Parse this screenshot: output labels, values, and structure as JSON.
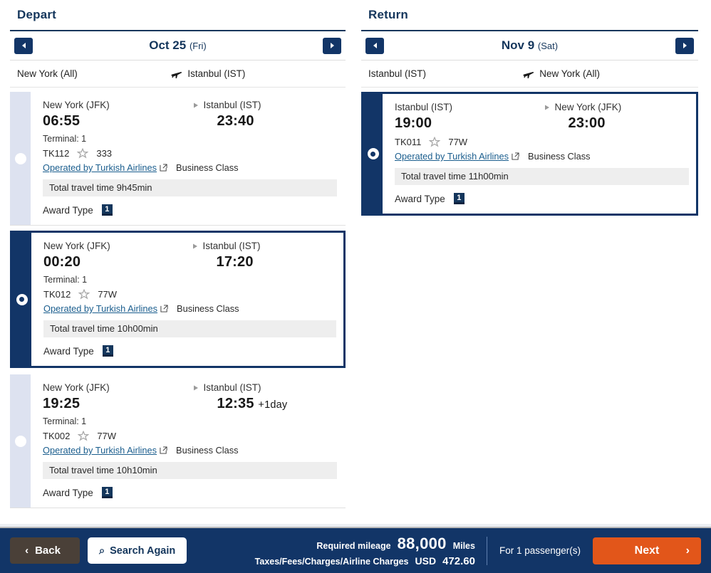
{
  "depart": {
    "section_title": "Depart",
    "date": "Oct 25",
    "day_of_week": "(Fri)",
    "prev_label": "◀",
    "next_label": "▶",
    "origin": "New York (All)",
    "destination": "Istanbul (IST)",
    "flights": [
      {
        "selected": false,
        "from_city": "New York (JFK)",
        "to_city": "Istanbul (IST)",
        "dep_time": "06:55",
        "arr_time": "23:40",
        "plus_day": "",
        "terminal": "Terminal: 1",
        "flight_no": "TK112",
        "equipment": "333",
        "operated_by": "Operated by Turkish Airlines",
        "cabin": "Business Class",
        "travel_time": "Total travel time 9h45min",
        "award_label": "Award Type",
        "award_type": "1"
      },
      {
        "selected": true,
        "from_city": "New York (JFK)",
        "to_city": "Istanbul (IST)",
        "dep_time": "00:20",
        "arr_time": "17:20",
        "plus_day": "",
        "terminal": "Terminal: 1",
        "flight_no": "TK012",
        "equipment": "77W",
        "operated_by": "Operated by Turkish Airlines",
        "cabin": "Business Class",
        "travel_time": "Total travel time 10h00min",
        "award_label": "Award Type",
        "award_type": "1"
      },
      {
        "selected": false,
        "from_city": "New York (JFK)",
        "to_city": "Istanbul (IST)",
        "dep_time": "19:25",
        "arr_time": "12:35",
        "plus_day": "+1day",
        "terminal": "Terminal: 1",
        "flight_no": "TK002",
        "equipment": "77W",
        "operated_by": "Operated by Turkish Airlines",
        "cabin": "Business Class",
        "travel_time": "Total travel time 10h10min",
        "award_label": "Award Type",
        "award_type": "1"
      }
    ]
  },
  "return": {
    "section_title": "Return",
    "date": "Nov 9",
    "day_of_week": "(Sat)",
    "prev_label": "◀",
    "next_label": "▶",
    "origin": "Istanbul (IST)",
    "destination": "New York (All)",
    "flights": [
      {
        "selected": true,
        "from_city": "Istanbul (IST)",
        "to_city": "New York (JFK)",
        "dep_time": "19:00",
        "arr_time": "23:00",
        "plus_day": "",
        "terminal": "",
        "flight_no": "TK011",
        "equipment": "77W",
        "operated_by": "Operated by Turkish Airlines",
        "cabin": "Business Class",
        "travel_time": "Total travel time 11h00min",
        "award_label": "Award Type",
        "award_type": "1"
      }
    ]
  },
  "footer": {
    "back_label": "Back",
    "search_again_label": "Search Again",
    "required_mileage_label": "Required mileage",
    "mileage_value": "88,000",
    "mileage_unit": "Miles",
    "taxes_label": "Taxes/Fees/Charges/Airline Charges",
    "currency": "USD",
    "amount": "472.60",
    "passengers": "For 1 passenger(s)",
    "next_label": "Next",
    "next_chevron": "›",
    "back_chevron": "‹",
    "search_icon_glyph": "⌕"
  },
  "colors": {
    "navy": "#123567",
    "navy_dark": "#14365c",
    "orange": "#e2561a",
    "link_blue": "#1b5e8e",
    "rail_light": "#dde2f0",
    "travel_bg": "#eeeeee",
    "back_brown": "#4a4038"
  }
}
